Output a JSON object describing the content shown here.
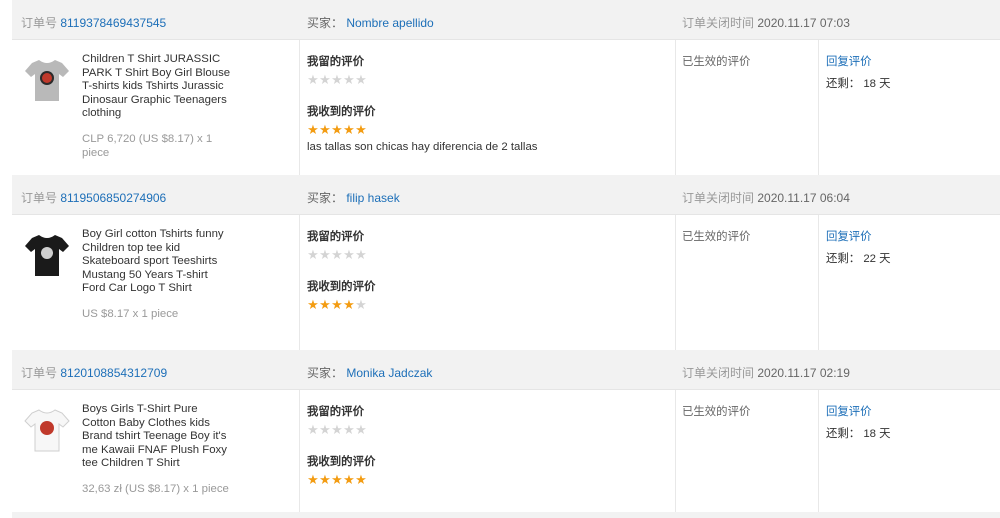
{
  "labels": {
    "order_no": "订单号",
    "buyer": "买家：",
    "close_time": "订单关闭时间",
    "my_review": "我留的评价",
    "received_review": "我收到的评价",
    "effective": "已生效的评价",
    "reply": "回复评价",
    "remaining_prefix": "还剩：",
    "days_suffix": "天"
  },
  "colors": {
    "link": "#1d6fb8",
    "star_on": "#f39c12",
    "star_off": "#d4d4d4",
    "header_bg": "#f2f2f2"
  },
  "orders": [
    {
      "order_id": "8119378469437545",
      "buyer_name": "Nombre apellido",
      "close_time": "2020.11.17 07:03",
      "product_title": "Children T Shirt JURASSIC PARK T Shirt Boy Girl Blouse T-shirts kids Tshirts Jurassic Dinosaur Graphic Teenagers clothing",
      "price": "CLP 6,720 (US $8.17) x 1 piece",
      "product_image": "gray-jurassic-park-tshirt",
      "my_rating": 0,
      "received_rating": 5,
      "received_comment": "las tallas son chicas hay diferencia de 2 tallas",
      "remaining_days": "18"
    },
    {
      "order_id": "8119506850274906",
      "buyer_name": "filip hasek",
      "close_time": "2020.11.17 06:04",
      "product_title": "Boy Girl cotton Tshirts funny Children top tee kid Skateboard sport Teeshirts Mustang 50 Years T-shirt Ford Car Logo T Shirt",
      "price": "US $8.17 x 1 piece",
      "product_image": "black-mustang-tshirt",
      "my_rating": 0,
      "received_rating": 4,
      "received_comment": "",
      "remaining_days": "22"
    },
    {
      "order_id": "8120108854312709",
      "buyer_name": "Monika Jadczak",
      "close_time": "2020.11.17 02:19",
      "product_title": "Boys Girls T-Shirt Pure Cotton Baby Clothes kids Brand tshirt Teenage Boy it's me Kawaii FNAF Plush Foxy tee Children T Shirt",
      "price": "32,63 zł (US $8.17) x 1 piece",
      "product_image": "white-fnaf-foxy-tshirt",
      "my_rating": 0,
      "received_rating": 5,
      "received_comment": "",
      "remaining_days": "18"
    }
  ]
}
